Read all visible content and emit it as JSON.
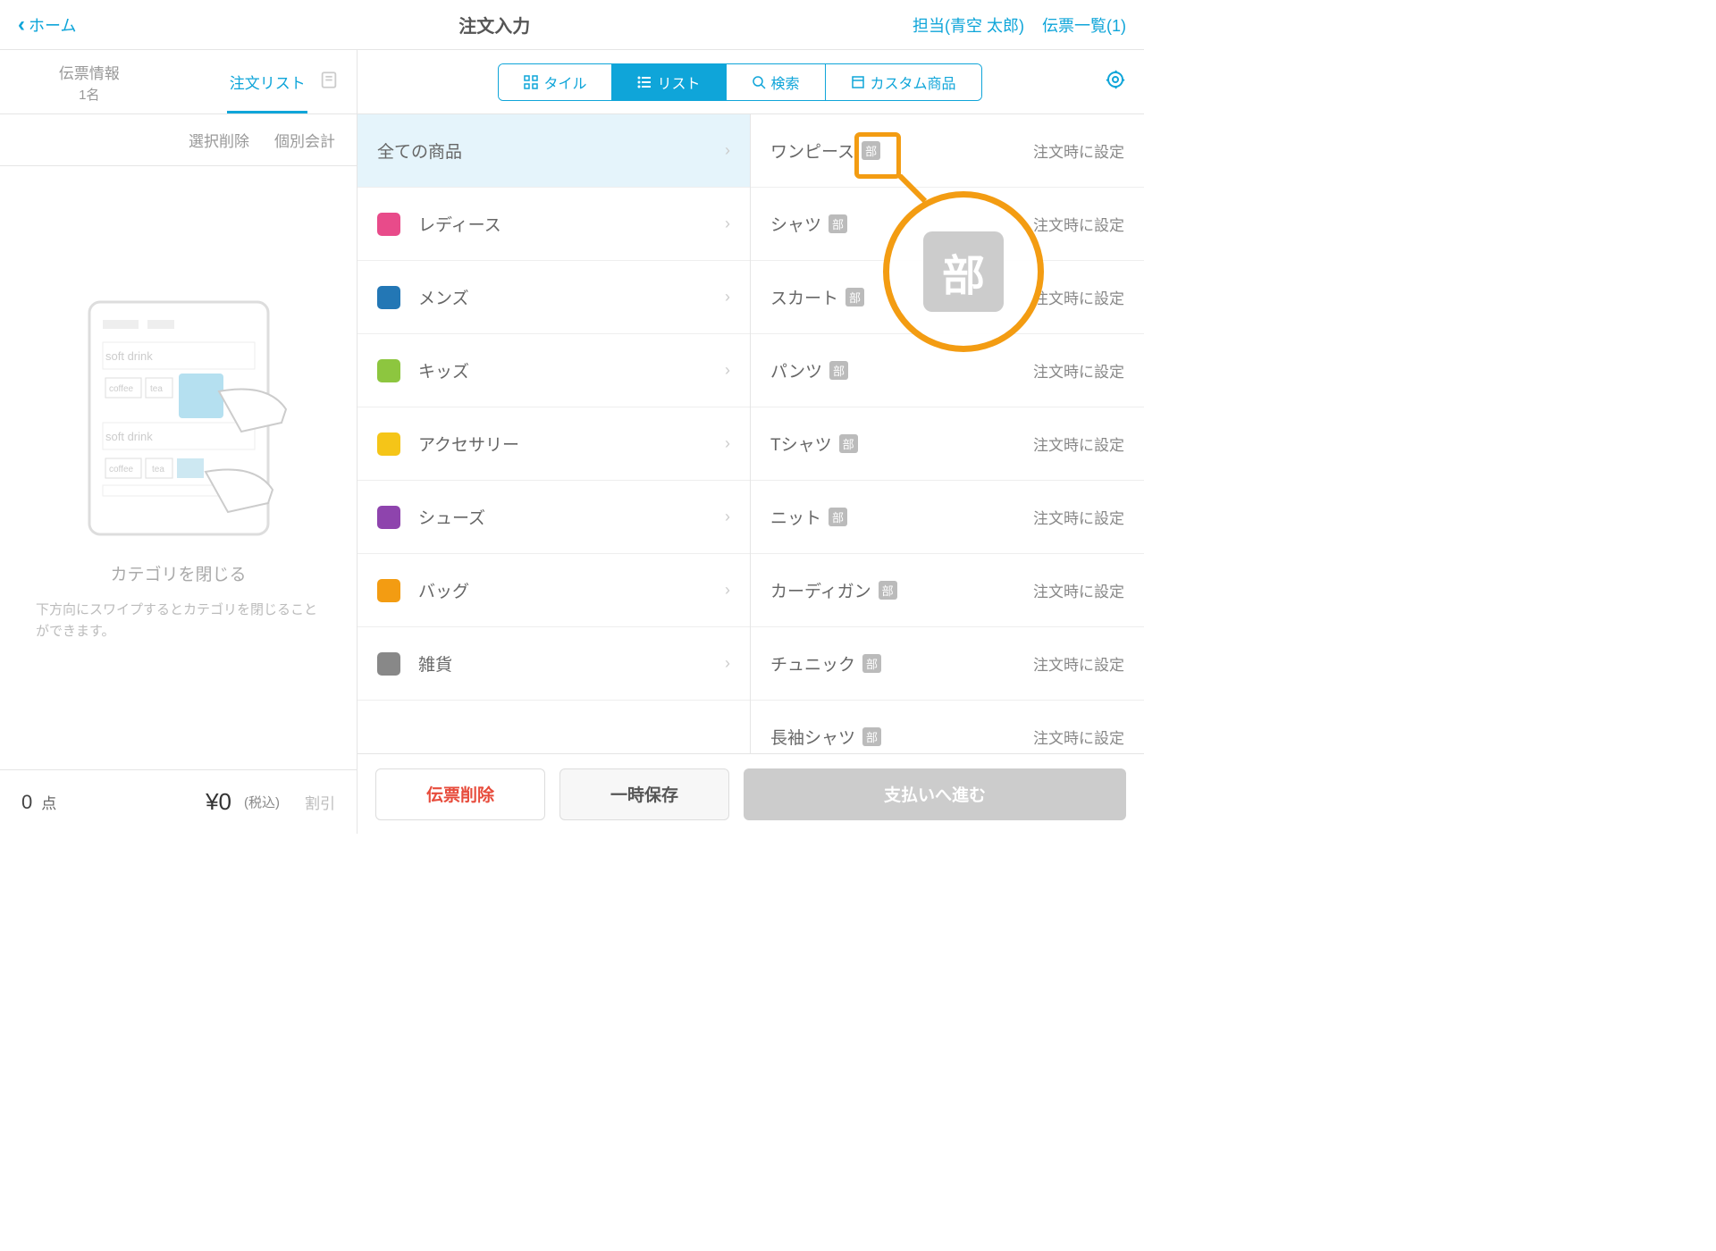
{
  "header": {
    "back": "ホーム",
    "title": "注文入力",
    "staff": "担当(青空 太郎)",
    "slips": "伝票一覧(1)"
  },
  "sidebar": {
    "tab1": "伝票情報",
    "tab1sub": "1名",
    "tab2": "注文リスト",
    "delSelection": "選択削除",
    "splitBill": "個別会計",
    "illTitle": "カテゴリを閉じる",
    "illDesc": "下方向にスワイプするとカテゴリを閉じることができます。",
    "count": "0",
    "countUnit": "点",
    "price": "¥0",
    "tax": "(税込)",
    "discount": "割引"
  },
  "toolbar": {
    "tile": "タイル",
    "list": "リスト",
    "search": "検索",
    "custom": "カスタム商品"
  },
  "categories": [
    {
      "name": "全ての商品",
      "all": true
    },
    {
      "name": "レディース",
      "color": "#e84b8a"
    },
    {
      "name": "メンズ",
      "color": "#2377b5"
    },
    {
      "name": "キッズ",
      "color": "#8dc63f"
    },
    {
      "name": "アクセサリー",
      "color": "#f5c518"
    },
    {
      "name": "シューズ",
      "color": "#8e44ad"
    },
    {
      "name": "バッグ",
      "color": "#f39c12"
    },
    {
      "name": "雑貨",
      "color": "#888888"
    }
  ],
  "products": [
    {
      "name": "ワンピース",
      "price": "注文時に設定"
    },
    {
      "name": "シャツ",
      "price": "注文時に設定"
    },
    {
      "name": "スカート",
      "price": "注文時に設定"
    },
    {
      "name": "パンツ",
      "price": "注文時に設定"
    },
    {
      "name": "Tシャツ",
      "price": "注文時に設定"
    },
    {
      "name": "ニット",
      "price": "注文時に設定"
    },
    {
      "name": "カーディガン",
      "price": "注文時に設定"
    },
    {
      "name": "チュニック",
      "price": "注文時に設定"
    },
    {
      "name": "長袖シャツ",
      "price": "注文時に設定"
    }
  ],
  "badge": "部",
  "footer": {
    "delete": "伝票削除",
    "hold": "一時保存",
    "pay": "支払いへ進む"
  }
}
